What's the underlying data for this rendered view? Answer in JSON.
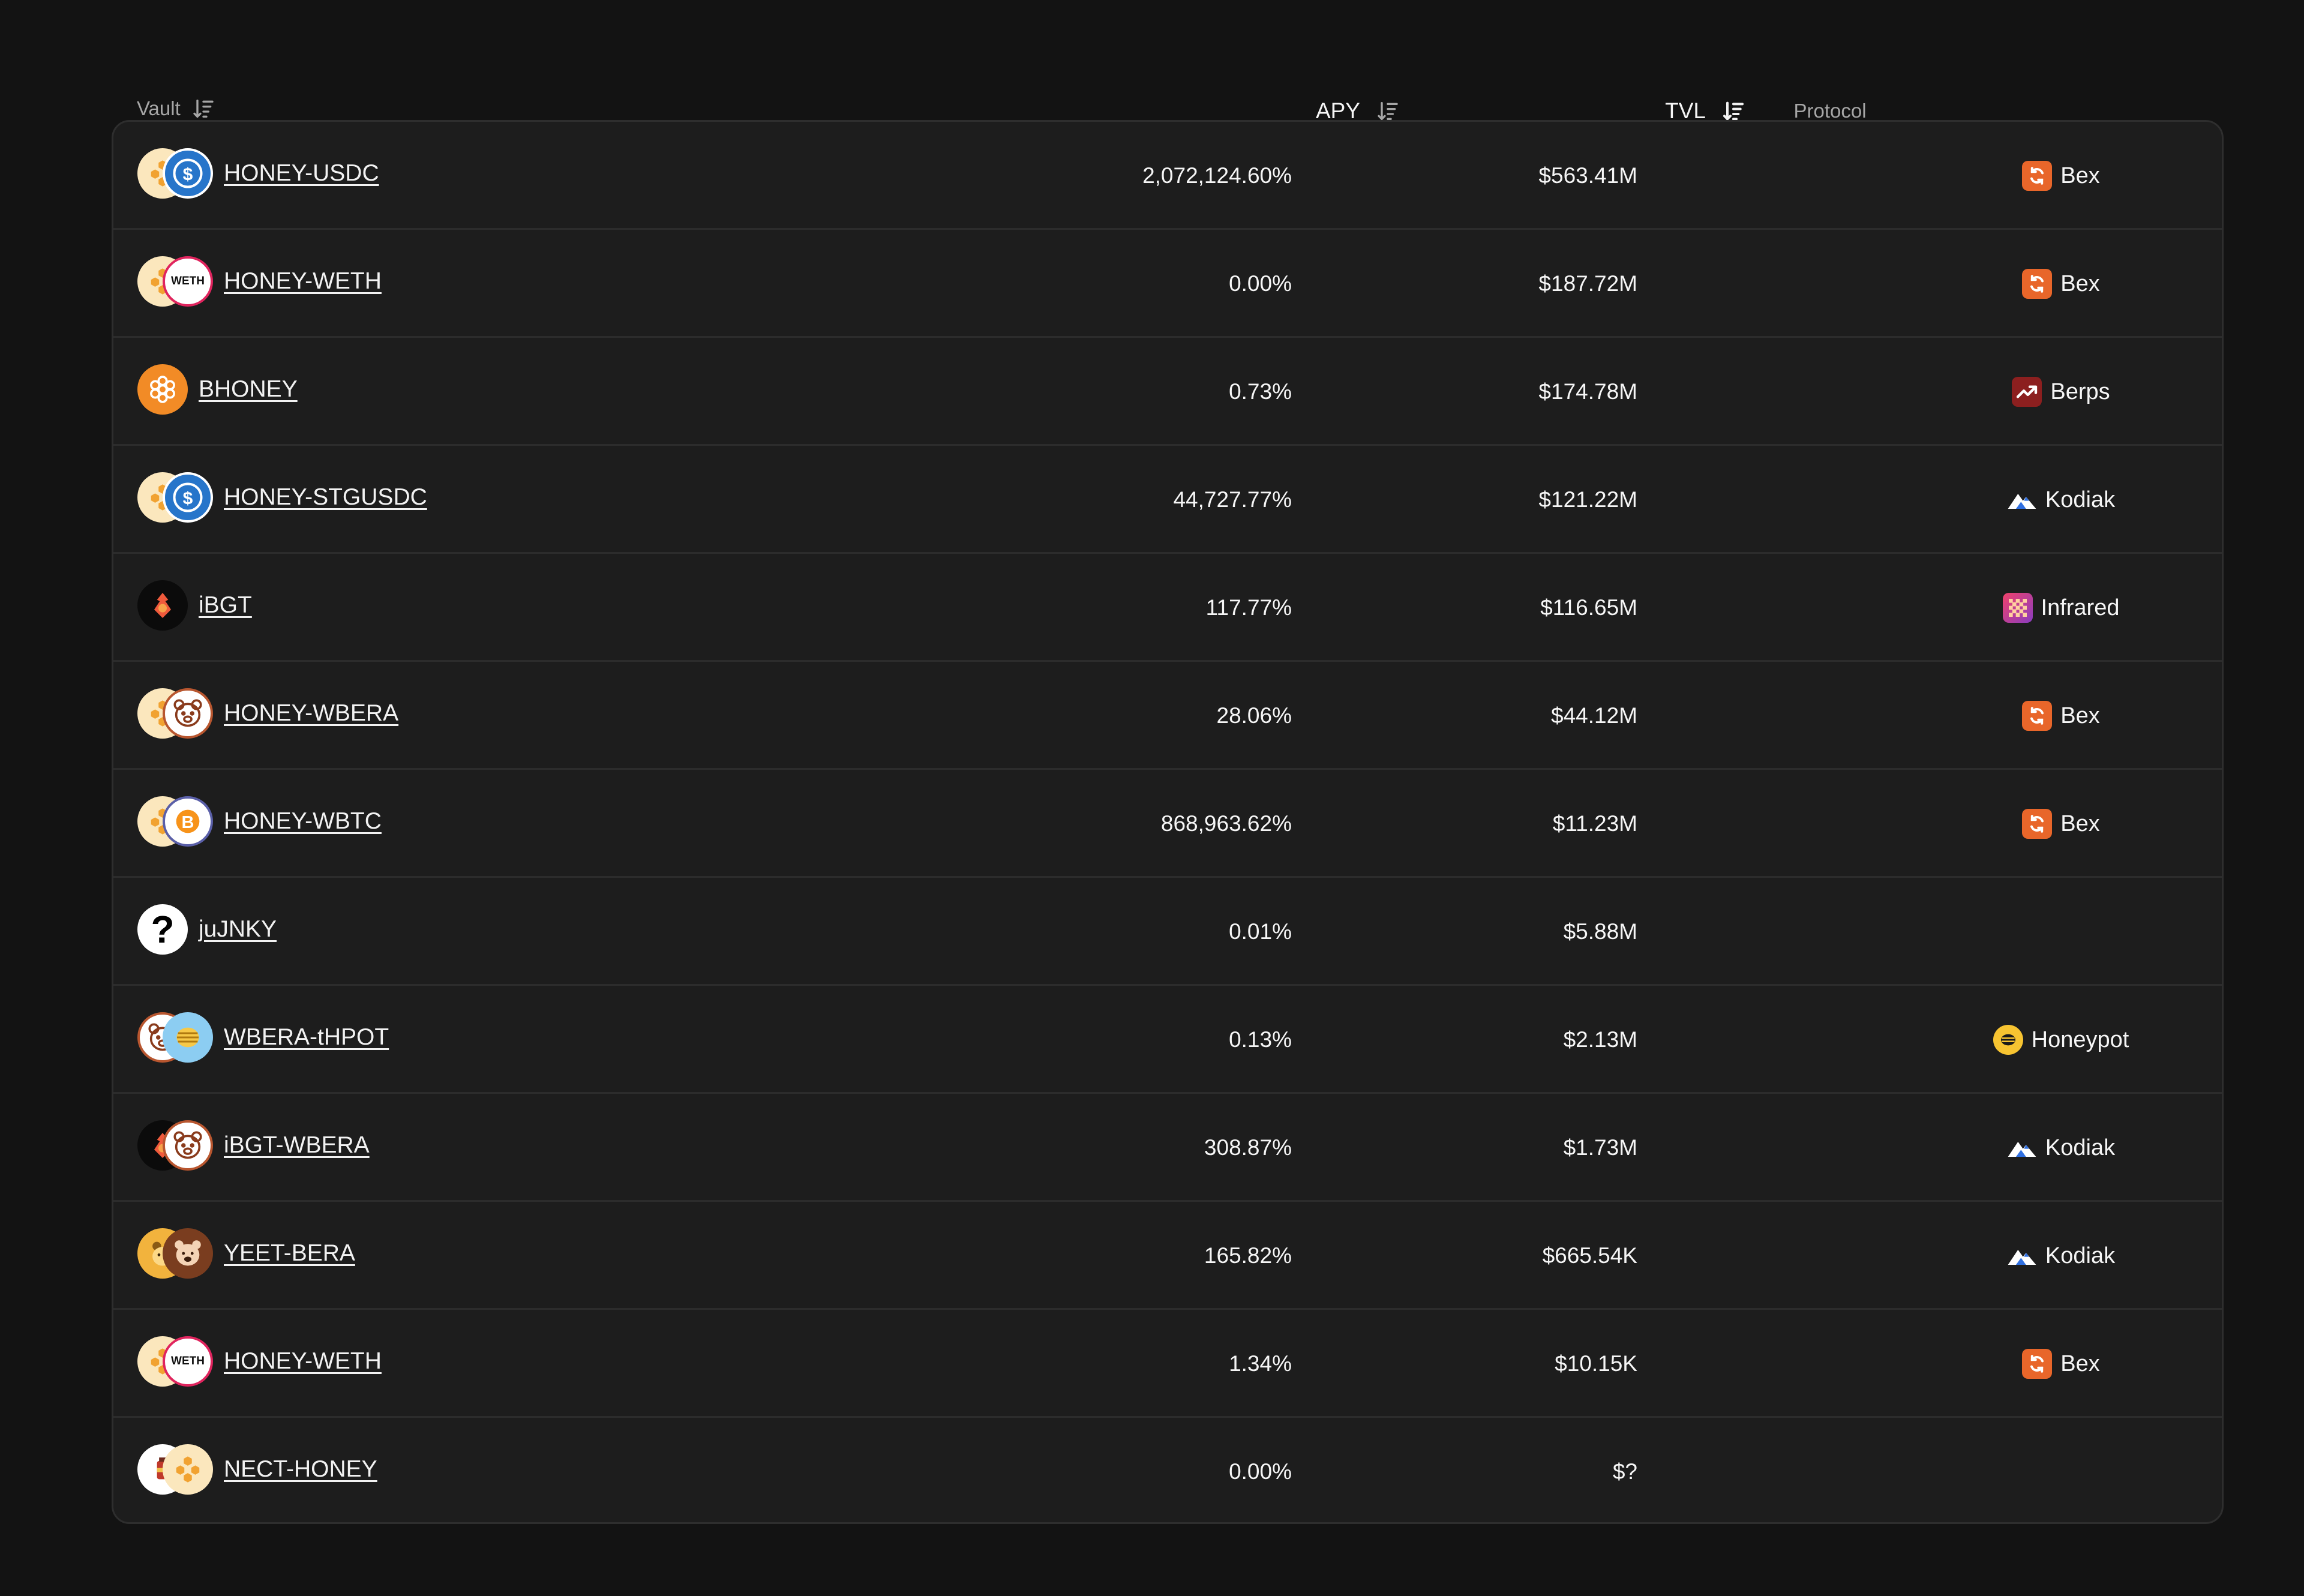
{
  "header": {
    "vault_label": "Vault",
    "apy_label": "APY",
    "tvl_label": "TVL",
    "protocol_label": "Protocol"
  },
  "colors": {
    "background": "#131313",
    "panel": "#1d1d1d",
    "border": "#2e2e2e",
    "bex": "#e8662a",
    "berps": "#8c1f1f",
    "honey": "#f2a733",
    "usdc": "#2775ca"
  },
  "vaults": [
    {
      "name": "HONEY-USDC",
      "apy": "2,072,124.60%",
      "tvl": "$563.41M",
      "protocol": "Bex",
      "icons": [
        "honey-icon",
        "usdc-icon"
      ]
    },
    {
      "name": "HONEY-WETH",
      "apy": "0.00%",
      "tvl": "$187.72M",
      "protocol": "Bex",
      "icons": [
        "honey-icon",
        "weth-icon"
      ]
    },
    {
      "name": "BHONEY",
      "apy": "0.73%",
      "tvl": "$174.78M",
      "protocol": "Berps",
      "icons": [
        "bhoney-icon"
      ]
    },
    {
      "name": "HONEY-STGUSDC",
      "apy": "44,727.77%",
      "tvl": "$121.22M",
      "protocol": "Kodiak",
      "icons": [
        "honey-icon",
        "usdc-icon"
      ]
    },
    {
      "name": "iBGT",
      "apy": "117.77%",
      "tvl": "$116.65M",
      "protocol": "Infrared",
      "icons": [
        "ibgt-icon"
      ]
    },
    {
      "name": "HONEY-WBERA",
      "apy": "28.06%",
      "tvl": "$44.12M",
      "protocol": "Bex",
      "icons": [
        "honey-icon",
        "wbera-icon"
      ]
    },
    {
      "name": "HONEY-WBTC",
      "apy": "868,963.62%",
      "tvl": "$11.23M",
      "protocol": "Bex",
      "icons": [
        "honey-icon",
        "wbtc-icon"
      ]
    },
    {
      "name": "juJNKY",
      "apy": "0.01%",
      "tvl": "$5.88M",
      "protocol": "",
      "icons": [
        "unknown-token-icon"
      ]
    },
    {
      "name": "WBERA-tHPOT",
      "apy": "0.13%",
      "tvl": "$2.13M",
      "protocol": "Honeypot",
      "icons": [
        "wbera-icon",
        "thpot-icon"
      ]
    },
    {
      "name": "iBGT-WBERA",
      "apy": "308.87%",
      "tvl": "$1.73M",
      "protocol": "Kodiak",
      "icons": [
        "ibgt-icon",
        "wbera-icon"
      ]
    },
    {
      "name": "YEET-BERA",
      "apy": "165.82%",
      "tvl": "$665.54K",
      "protocol": "Kodiak",
      "icons": [
        "yeet-icon",
        "bera-icon"
      ]
    },
    {
      "name": "HONEY-WETH",
      "apy": "1.34%",
      "tvl": "$10.15K",
      "protocol": "Bex",
      "icons": [
        "honey-icon",
        "weth-icon"
      ]
    },
    {
      "name": "NECT-HONEY",
      "apy": "0.00%",
      "tvl": "$?",
      "protocol": "",
      "icons": [
        "nect-icon",
        "honey-icon"
      ]
    }
  ]
}
